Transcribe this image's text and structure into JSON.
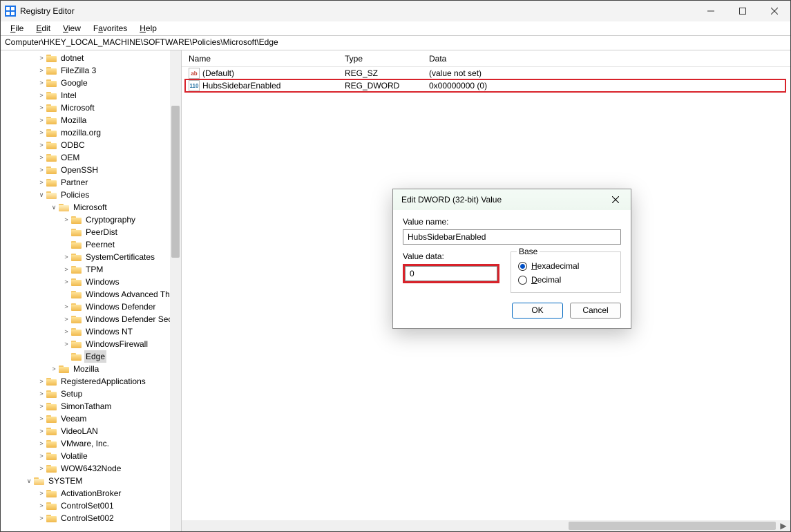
{
  "window": {
    "title": "Registry Editor"
  },
  "menu": {
    "file": "File",
    "edit": "Edit",
    "view": "View",
    "favorites": "Favorites",
    "help": "Help"
  },
  "address": "Computer\\HKEY_LOCAL_MACHINE\\SOFTWARE\\Policies\\Microsoft\\Edge",
  "columns": {
    "name": "Name",
    "type": "Type",
    "data": "Data"
  },
  "values": [
    {
      "icon": "str",
      "name": "(Default)",
      "type": "REG_SZ",
      "data": "(value not set)"
    },
    {
      "icon": "bin",
      "name": "HubsSidebarEnabled",
      "type": "REG_DWORD",
      "data": "0x00000000 (0)"
    }
  ],
  "tree": {
    "dotnet": "dotnet",
    "filezilla": "FileZilla 3",
    "google": "Google",
    "intel": "Intel",
    "microsoft": "Microsoft",
    "mozilla": "Mozilla",
    "mozillaorg": "mozilla.org",
    "odbc": "ODBC",
    "oem": "OEM",
    "openssh": "OpenSSH",
    "partner": "Partner",
    "policies": "Policies",
    "policies_microsoft": "Microsoft",
    "cryptography": "Cryptography",
    "peerdist": "PeerDist",
    "peernet": "Peernet",
    "systemcertificates": "SystemCertificates",
    "tpm": "TPM",
    "windows": "Windows",
    "windows_adv": "Windows Advanced Th",
    "windows_def": "Windows Defender",
    "windows_def_sec": "Windows Defender Sec",
    "windows_nt": "Windows NT",
    "windows_firewall": "WindowsFirewall",
    "edge": "Edge",
    "policies_mozilla": "Mozilla",
    "regapps": "RegisteredApplications",
    "setup": "Setup",
    "simontatham": "SimonTatham",
    "veeam": "Veeam",
    "videolan": "VideoLAN",
    "vmware": "VMware, Inc.",
    "volatile": "Volatile",
    "wow64": "WOW6432Node",
    "system": "SYSTEM",
    "activationbroker": "ActivationBroker",
    "controlset001": "ControlSet001",
    "controlset002": "ControlSet002"
  },
  "dialog": {
    "title": "Edit DWORD (32-bit) Value",
    "value_name_label": "Value name:",
    "value_name": "HubsSidebarEnabled",
    "value_data_label": "Value data:",
    "value_data": "0",
    "base_label": "Base",
    "hex": "Hexadecimal",
    "dec": "Decimal",
    "ok": "OK",
    "cancel": "Cancel"
  }
}
